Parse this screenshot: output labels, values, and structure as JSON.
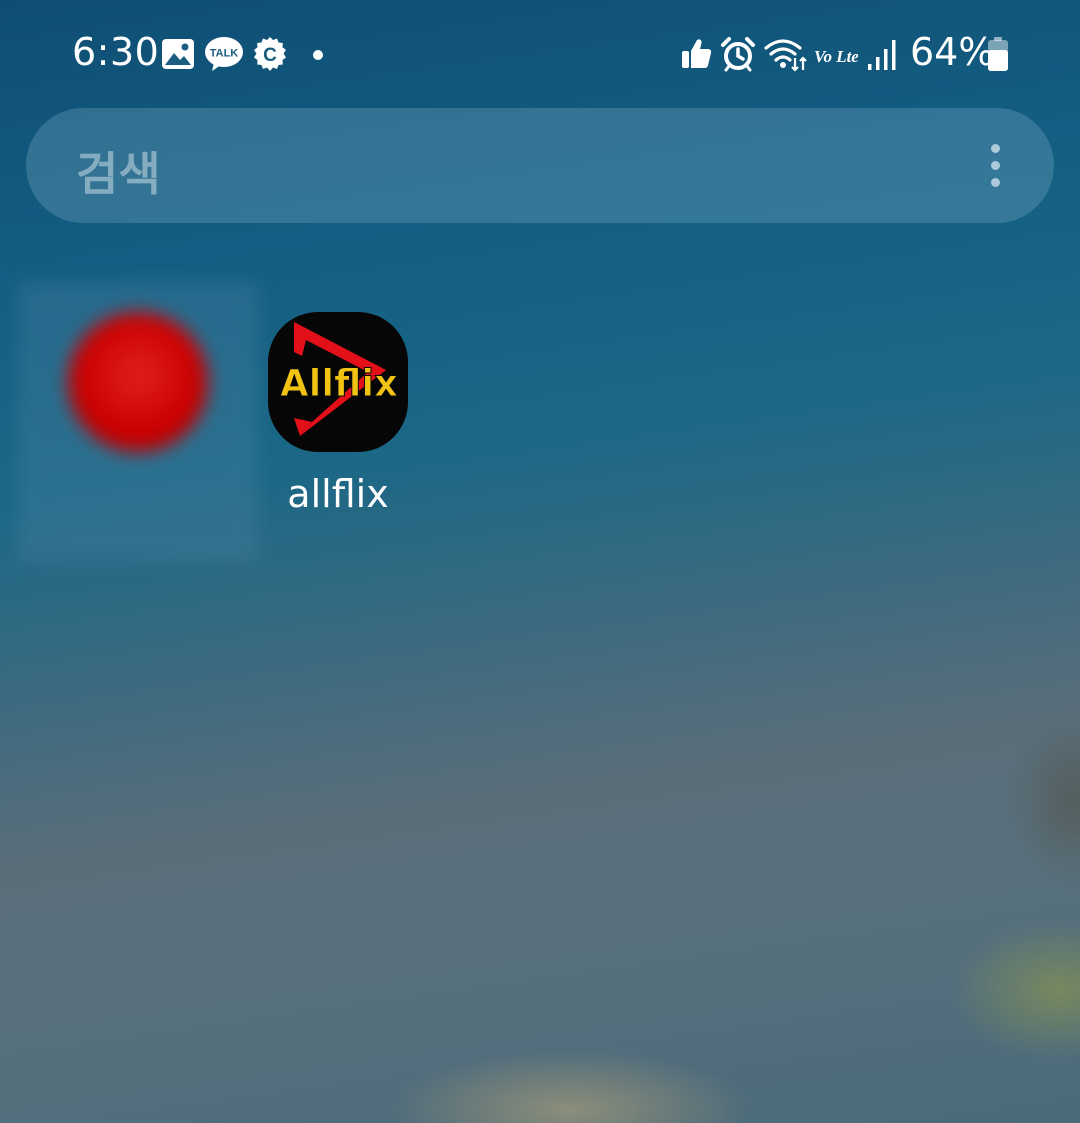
{
  "status_bar": {
    "time": "6:30",
    "battery_percent": "64%",
    "left_icons": [
      "gallery-notification-icon",
      "kakaotalk-icon",
      "c-app-icon",
      "more-notifications-dot"
    ],
    "right_icons": [
      "thumbs-up-icon",
      "alarm-icon",
      "wifi-icon",
      "volte-icon",
      "signal-icon",
      "battery-icon"
    ],
    "talk_badge_text": "TALK",
    "c_badge_text": "C",
    "volte_text": "Vo Lte"
  },
  "search": {
    "placeholder": "검색",
    "menu_icon": "more-vertical-icon"
  },
  "apps": [
    {
      "label": "",
      "icon": "blurred-red-app-icon",
      "blurred": true,
      "icon_color": "#d01010"
    },
    {
      "label": "allflix",
      "icon": "allflix-logo-icon",
      "logo_text": "Allflix",
      "logo_text_color": "#f2c313",
      "logo_accent_color": "#e3101a",
      "background_color": "#060606"
    }
  ]
}
